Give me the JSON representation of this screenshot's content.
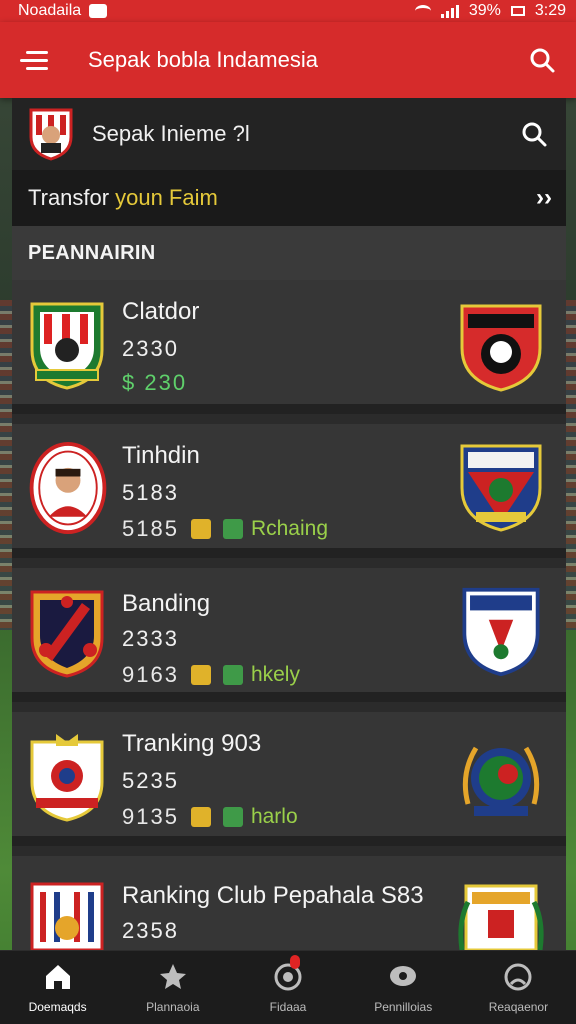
{
  "status_bar": {
    "carrier": "Noadaila",
    "battery": "39%",
    "time": "3:29"
  },
  "app_bar": {
    "title": "Sepak bobla  Indamesia"
  },
  "search": {
    "query": "Sepak Inieme ?l"
  },
  "transfer": {
    "label_white": "Transfor",
    "label_yellow": "youn  Faim"
  },
  "section": {
    "title": "PEANNAIRIN"
  },
  "clubs": [
    {
      "name": "Clatdor",
      "value1": "2330",
      "value2": "$ 230",
      "tag": ""
    },
    {
      "name": "Tinhdin",
      "value1": "5183",
      "value2": "5185",
      "tag": "Rchaing"
    },
    {
      "name": "Banding",
      "value1": "2333",
      "value2": "9163",
      "tag": "hkely"
    },
    {
      "name": "Tranking 903",
      "value1": "5235",
      "value2": "9135",
      "tag": "harlo"
    },
    {
      "name": "Ranking Club Pepahala S83",
      "value1": "2358",
      "value2": "",
      "tag": ""
    }
  ],
  "bottom_nav": [
    {
      "label": "Doemaqds",
      "icon": "home-icon"
    },
    {
      "label": "Plannaoia",
      "icon": "star-icon"
    },
    {
      "label": "Fidaaa",
      "icon": "ball-icon"
    },
    {
      "label": "Pennilloias",
      "icon": "chat-icon"
    },
    {
      "label": "Reaqaenor",
      "icon": "profile-icon"
    }
  ],
  "colors": {
    "accent": "#d62b2b",
    "highlight_yellow": "#e5c93a",
    "positive_green": "#5fd06b"
  }
}
